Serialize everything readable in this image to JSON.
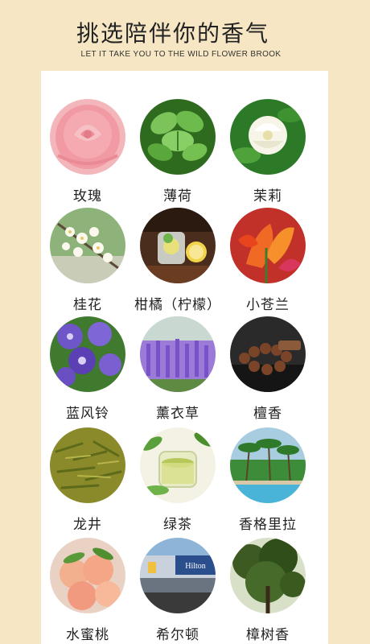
{
  "header": {
    "title": "挑选陪伴你的香气",
    "subtitle": "LET IT TAKE YOU TO THE WILD FLOWER BROOK"
  },
  "scents": [
    {
      "label": "玫瑰",
      "icon": "rose-image",
      "color": "#f2a0a8"
    },
    {
      "label": "薄荷",
      "icon": "mint-image",
      "color": "#3f8a2b"
    },
    {
      "label": "茉莉",
      "icon": "jasmine-image",
      "color": "#2f7d2a"
    },
    {
      "label": "桂花",
      "icon": "osmanthus-image",
      "color": "#6aa05a"
    },
    {
      "label": "柑橘（柠檬）",
      "icon": "citrus-lemon-image",
      "color": "#4a2d1c"
    },
    {
      "label": "小苍兰",
      "icon": "freesia-image",
      "color": "#e8451e"
    },
    {
      "label": "蓝风铃",
      "icon": "bluebell-image",
      "color": "#5a3fb5"
    },
    {
      "label": "薰衣草",
      "icon": "lavender-image",
      "color": "#8a5fd0"
    },
    {
      "label": "檀香",
      "icon": "sandalwood-beads-image",
      "color": "#3a2418"
    },
    {
      "label": "龙井",
      "icon": "longjing-tea-image",
      "color": "#7c8c2a"
    },
    {
      "label": "绿茶",
      "icon": "green-tea-image",
      "color": "#b7c85a"
    },
    {
      "label": "香格里拉",
      "icon": "shangri-la-resort-image",
      "color": "#3d8c3a"
    },
    {
      "label": "水蜜桃",
      "icon": "peach-image",
      "color": "#f0a58a"
    },
    {
      "label": "希尔顿",
      "icon": "hilton-hotel-image",
      "color": "#2a4f8c"
    },
    {
      "label": "樟树香",
      "icon": "camphor-tree-image",
      "color": "#3c5a22"
    }
  ]
}
